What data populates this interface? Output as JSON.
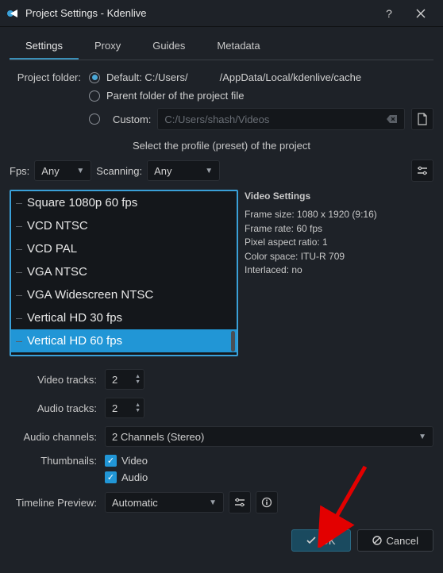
{
  "window": {
    "title": "Project Settings - Kdenlive"
  },
  "tabs": [
    "Settings",
    "Proxy",
    "Guides",
    "Metadata"
  ],
  "active_tab": 0,
  "folder": {
    "label": "Project folder:",
    "default_prefix": "Default: C:/Users/",
    "default_suffix": "/AppData/Local/kdenlive/cache",
    "parent": "Parent folder of the project file",
    "custom": "Custom:",
    "custom_path": "C:/Users/shash/Videos"
  },
  "profile": {
    "caption": "Select the profile (preset) of the project",
    "fps_label": "Fps:",
    "fps_value": "Any",
    "scan_label": "Scanning:",
    "scan_value": "Any",
    "items": [
      "Square 1080p 60 fps",
      "VCD NTSC",
      "VCD PAL",
      "VGA NTSC",
      "VGA Widescreen NTSC",
      "Vertical HD 30 fps",
      "Vertical HD 60 fps"
    ],
    "selected": 6
  },
  "video_settings": {
    "heading": "Video Settings",
    "frame_size": "Frame size: 1080 x 1920 (9:16)",
    "frame_rate": "Frame rate: 60 fps",
    "par": "Pixel aspect ratio: 1",
    "colorspace": "Color space: ITU-R 709",
    "interlaced": "Interlaced: no"
  },
  "tracks": {
    "video_label": "Video tracks:",
    "video_value": "2",
    "audio_label": "Audio tracks:",
    "audio_value": "2",
    "channels_label": "Audio channels:",
    "channels_value": "2 Channels (Stereo)",
    "thumbs_label": "Thumbnails:",
    "thumb_video": "Video",
    "thumb_audio": "Audio",
    "preview_label": "Timeline Preview:",
    "preview_value": "Automatic"
  },
  "buttons": {
    "ok": "OK",
    "cancel": "Cancel"
  }
}
